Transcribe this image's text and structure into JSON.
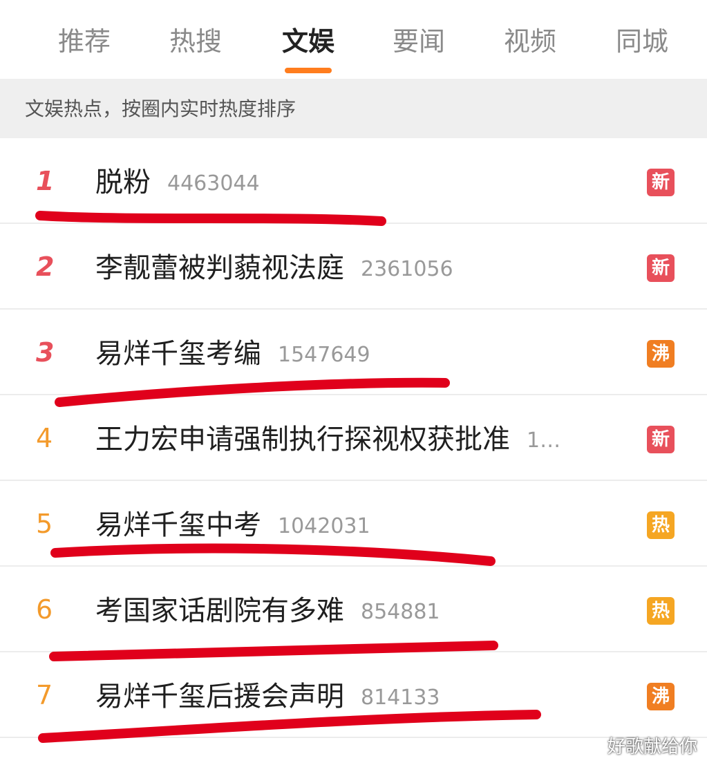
{
  "tabs": [
    {
      "label": "推荐"
    },
    {
      "label": "热搜"
    },
    {
      "label": "文娱"
    },
    {
      "label": "要闻"
    },
    {
      "label": "视频"
    },
    {
      "label": "同城"
    }
  ],
  "active_tab": "文娱",
  "subheader": "文娱热点，按圈内实时热度排序",
  "items": [
    {
      "rank": "1",
      "title": "脱粉",
      "heat": "4463044",
      "badge": "新",
      "badge_color": "#e8505b"
    },
    {
      "rank": "2",
      "title": "李靓蕾被判藐视法庭",
      "heat": "2361056",
      "badge": "新",
      "badge_color": "#e8505b"
    },
    {
      "rank": "3",
      "title": "易烊千玺考编",
      "heat": "1547649",
      "badge": "沸",
      "badge_color": "#f07e22"
    },
    {
      "rank": "4",
      "title": "王力宏申请强制执行探视权获批准",
      "heat": "1…",
      "badge": "新",
      "badge_color": "#e8505b"
    },
    {
      "rank": "5",
      "title": "易烊千玺中考",
      "heat": "1042031",
      "badge": "热",
      "badge_color": "#f5a623"
    },
    {
      "rank": "6",
      "title": "考国家话剧院有多难",
      "heat": "854881",
      "badge": "热",
      "badge_color": "#f5a623"
    },
    {
      "rank": "7",
      "title": "易烊千玺后援会声明",
      "heat": "814133",
      "badge": "沸",
      "badge_color": "#f07e22"
    }
  ],
  "watermark": "好歌献给你",
  "colors": {
    "accent": "#ff7d1e",
    "annotation_red": "#e0001b"
  }
}
